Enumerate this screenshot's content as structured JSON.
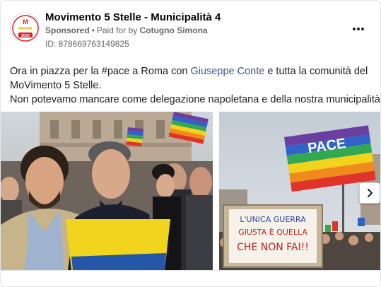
{
  "header": {
    "page_name": "Movimento 5 Stelle - Municipalità 4",
    "sponsored_label": "Sponsored",
    "separator": "•",
    "paid_for_prefix": "Paid for by",
    "payer": "Cotugno Simona",
    "ad_id": "ID: 878669763149825",
    "avatar_year": "2050",
    "avatar_brand": "MOVIMENTO"
  },
  "post": {
    "line1_a": "Ora in piazza per la #pace a Roma con",
    "mention": "Giuseppe Conte",
    "line1_b": "e tutta la comunità del",
    "line2": "MoVimento 5 Stelle.",
    "line3": "Non potevamo mancare come delegazione napoletana e della nostra municipalità."
  },
  "images": {
    "left_alt": "Selfie in piazza",
    "right_sign_line1": "L'UNICA GUERRA",
    "right_sign_line2": "GIUSTA È QUELLA",
    "right_sign_line3": "CHE NON FAI!!",
    "right_flag_text": "PACE"
  },
  "colors": {
    "brand_red": "#d81e1e",
    "link_blue": "#385898",
    "text_primary": "#1c1e21",
    "text_secondary": "#65676b"
  },
  "icons": {
    "more": "more-horizontal-icon",
    "next": "chevron-right-icon"
  }
}
